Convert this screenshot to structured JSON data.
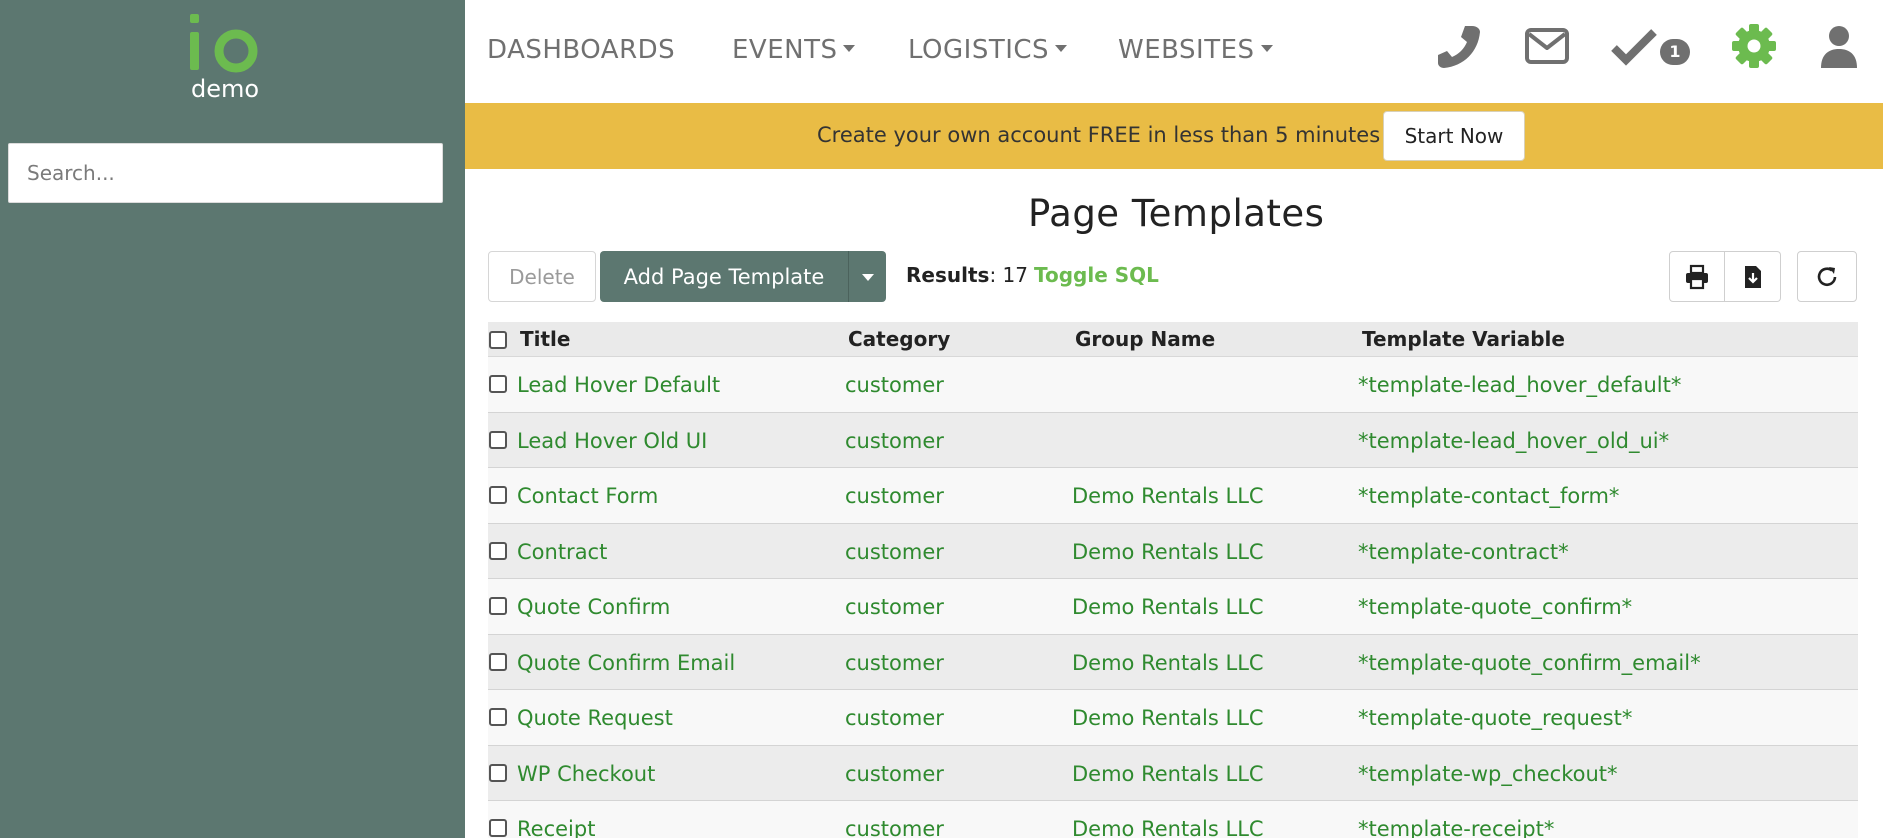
{
  "sidebar": {
    "logo_text": "demo",
    "search_placeholder": "Search..."
  },
  "nav": {
    "items": [
      {
        "label": "DASHBOARDS",
        "has_caret": false
      },
      {
        "label": "EVENTS",
        "has_caret": true
      },
      {
        "label": "LOGISTICS",
        "has_caret": true
      },
      {
        "label": "WEBSITES",
        "has_caret": true
      }
    ],
    "icons": [
      "phone-icon",
      "envelope-icon",
      "checkmark-icon",
      "gear-icon",
      "user-icon"
    ],
    "tasks_badge": "1",
    "accent_color": "#6cbb4f"
  },
  "banner": {
    "text": "Create your own account FREE in less than 5 minutes",
    "button_label": "Start Now",
    "color": "#e9bc45"
  },
  "main": {
    "title": "Page Templates",
    "delete_label": "Delete",
    "add_label": "Add Page Template",
    "results_label": "Results",
    "results_count": "17",
    "toggle_sql_label": "Toggle SQL",
    "toolbar_icons": [
      "print-icon",
      "download-file-icon",
      "refresh-icon"
    ]
  },
  "table": {
    "columns": [
      "Title",
      "Category",
      "Group Name",
      "Template Variable"
    ],
    "rows": [
      {
        "title": "Lead Hover Default",
        "category": "customer",
        "group": "",
        "variable": "*template-lead_hover_default*"
      },
      {
        "title": "Lead Hover Old UI",
        "category": "customer",
        "group": "",
        "variable": "*template-lead_hover_old_ui*"
      },
      {
        "title": "Contact Form",
        "category": "customer",
        "group": "Demo Rentals LLC",
        "variable": "*template-contact_form*"
      },
      {
        "title": "Contract",
        "category": "customer",
        "group": "Demo Rentals LLC",
        "variable": "*template-contract*"
      },
      {
        "title": "Quote Confirm",
        "category": "customer",
        "group": "Demo Rentals LLC",
        "variable": "*template-quote_confirm*"
      },
      {
        "title": "Quote Confirm Email",
        "category": "customer",
        "group": "Demo Rentals LLC",
        "variable": "*template-quote_confirm_email*"
      },
      {
        "title": "Quote Request",
        "category": "customer",
        "group": "Demo Rentals LLC",
        "variable": "*template-quote_request*"
      },
      {
        "title": "WP Checkout",
        "category": "customer",
        "group": "Demo Rentals LLC",
        "variable": "*template-wp_checkout*"
      },
      {
        "title": "Receipt",
        "category": "customer",
        "group": "Demo Rentals LLC",
        "variable": "*template-receipt*"
      }
    ]
  }
}
